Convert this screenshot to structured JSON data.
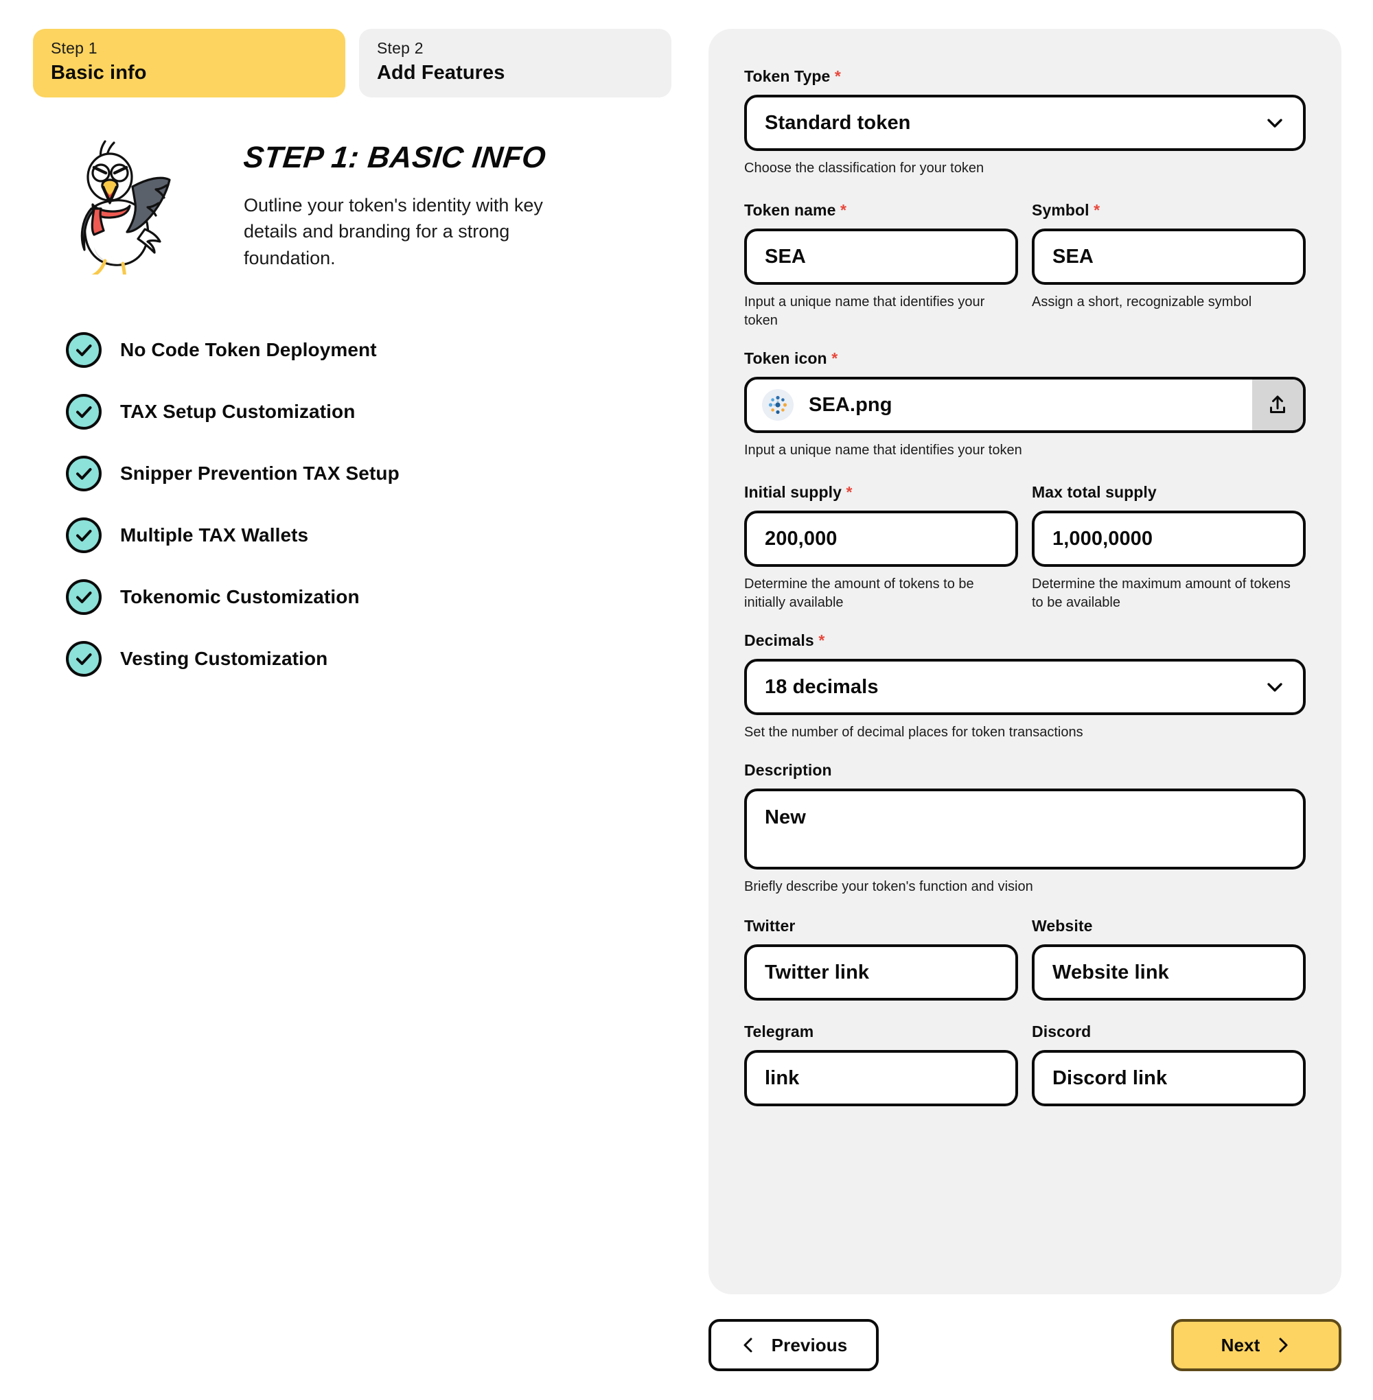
{
  "steps": [
    {
      "number": "Step 1",
      "name": "Basic info",
      "active": true
    },
    {
      "number": "Step 2",
      "name": "Add Features",
      "active": false
    }
  ],
  "hero": {
    "mascot_icon": "seagull-mascot-icon",
    "title": "STEP 1: BASIC INFO",
    "subtitle": "Outline your token's identity with key details and branding for a strong foundation."
  },
  "features": [
    {
      "icon": "check-circle-icon",
      "label": "No Code Token Deployment"
    },
    {
      "icon": "check-circle-icon",
      "label": "TAX Setup Customization"
    },
    {
      "icon": "check-circle-icon",
      "label": "Snipper Prevention TAX Setup"
    },
    {
      "icon": "check-circle-icon",
      "label": "Multiple TAX Wallets"
    },
    {
      "icon": "check-circle-icon",
      "label": "Tokenomic Customization"
    },
    {
      "icon": "check-circle-icon",
      "label": "Vesting Customization"
    }
  ],
  "form": {
    "token_type": {
      "label": "Token Type",
      "required": "*",
      "value": "Standard token",
      "hint": "Choose the classification for your token",
      "icon": "chevron-down-icon"
    },
    "token_name": {
      "label": "Token name",
      "required": "*",
      "value": "SEA",
      "hint": "Input a unique name that identifies your token"
    },
    "symbol": {
      "label": "Symbol",
      "required": "*",
      "value": "SEA",
      "hint": "Assign a short, recognizable symbol"
    },
    "token_icon": {
      "label": "Token icon",
      "required": "*",
      "file_name": "SEA.png",
      "thumb_icon": "token-network-icon",
      "upload_icon": "upload-icon",
      "hint": "Input a unique name that identifies your token"
    },
    "initial_supply": {
      "label": "Initial supply",
      "required": "*",
      "value": "200,000",
      "hint": "Determine the amount of tokens to be initially available"
    },
    "max_total_supply": {
      "label": "Max total supply",
      "required": "",
      "value": "1,000,0000",
      "hint": "Determine the maximum amount of tokens to be available"
    },
    "decimals": {
      "label": "Decimals",
      "required": "*",
      "value": "18 decimals",
      "hint": "Set the number of decimal places for token transactions",
      "icon": "chevron-down-icon"
    },
    "description": {
      "label": "Description",
      "required": "",
      "value": "New",
      "hint": "Briefly describe your token's function and vision"
    },
    "twitter": {
      "label": "Twitter",
      "value": "",
      "placeholder": "Twitter link"
    },
    "website": {
      "label": "Website",
      "value": "",
      "placeholder": "Website link"
    },
    "telegram": {
      "label": "Telegram",
      "value": "",
      "placeholder": "link"
    },
    "discord": {
      "label": "Discord",
      "value": "",
      "placeholder": "Discord link"
    }
  },
  "nav": {
    "previous_label": "Previous",
    "previous_icon": "chevron-left-icon",
    "next_label": "Next",
    "next_icon": "chevron-right-icon"
  },
  "colors": {
    "accent_yellow": "#fcd45f",
    "next_border": "#5e4a19",
    "mint": "#8ce1d9",
    "panel_bg": "#f1f1f1",
    "tab_inactive_bg": "#f0f0f0",
    "required_red": "#e8483c",
    "upload_btn_bg": "#d6d6d6"
  }
}
